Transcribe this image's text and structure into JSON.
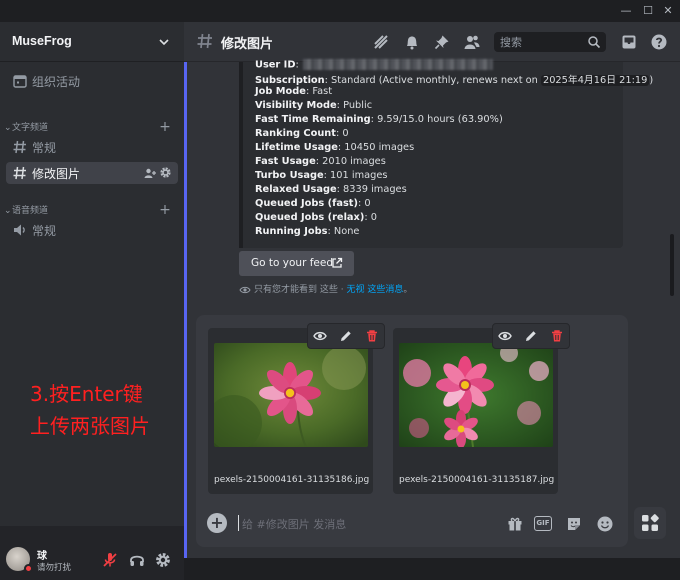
{
  "window": {
    "minimize": "—",
    "maximize": "☐",
    "close": "✕"
  },
  "server": {
    "name": "MuseFrog"
  },
  "sidebar": {
    "events_label": "组织活动",
    "text_category": "文字频道",
    "text_channels": [
      {
        "label": "常规"
      },
      {
        "label": "修改图片"
      }
    ],
    "voice_category": "语音频道",
    "voice_channels": [
      {
        "label": "常规"
      }
    ]
  },
  "user": {
    "name": "球",
    "status": "请勿打扰"
  },
  "header": {
    "channel": "修改图片",
    "search_placeholder": "搜索"
  },
  "embed": {
    "rows": [
      {
        "key": "User ID",
        "value": ""
      },
      {
        "key": "Subscription",
        "value": ": Standard (Active monthly, renews next on ",
        "date": "2025年4月16日 21:19",
        "tail": ")"
      },
      {
        "key": "Job Mode",
        "value": ": Fast"
      },
      {
        "key": "Visibility Mode",
        "value": ": Public"
      },
      {
        "key": "Fast Time Remaining",
        "value": ": 9.59/15.0 hours (63.90%)"
      },
      {
        "key": "Ranking Count",
        "value": ": 0"
      },
      {
        "key": "Lifetime Usage",
        "value": ": 10450 images"
      },
      {
        "key": "Fast Usage",
        "value": ": 2010 images"
      },
      {
        "key": "Turbo Usage",
        "value": ": 101 images"
      },
      {
        "key": "Relaxed Usage",
        "value": ": 8339 images"
      },
      {
        "key": "Queued Jobs (fast)",
        "value": ": 0"
      },
      {
        "key": "Queued Jobs (relax)",
        "value": ": 0"
      },
      {
        "key": "Running Jobs",
        "value": ": None"
      }
    ]
  },
  "feed_button": {
    "label": "Go to your feed"
  },
  "ephemeral": {
    "text": "只有您才能看到 这些 · ",
    "link": "无视 这些消息",
    "end": "。"
  },
  "attachments": [
    {
      "filename": "pexels-2150004161-31135186.jpg"
    },
    {
      "filename": "pexels-2150004161-31135187.jpg"
    }
  ],
  "composer": {
    "placeholder": "给 #修改图片 发消息",
    "gif_label": "GIF"
  },
  "annotation": {
    "line1": "3.按Enter键",
    "line2": "上传两张图片"
  },
  "colors": {
    "accent": "#5865f2",
    "annotation": "#ff2020",
    "delete": "#f23f43",
    "link": "#00a8fc"
  }
}
